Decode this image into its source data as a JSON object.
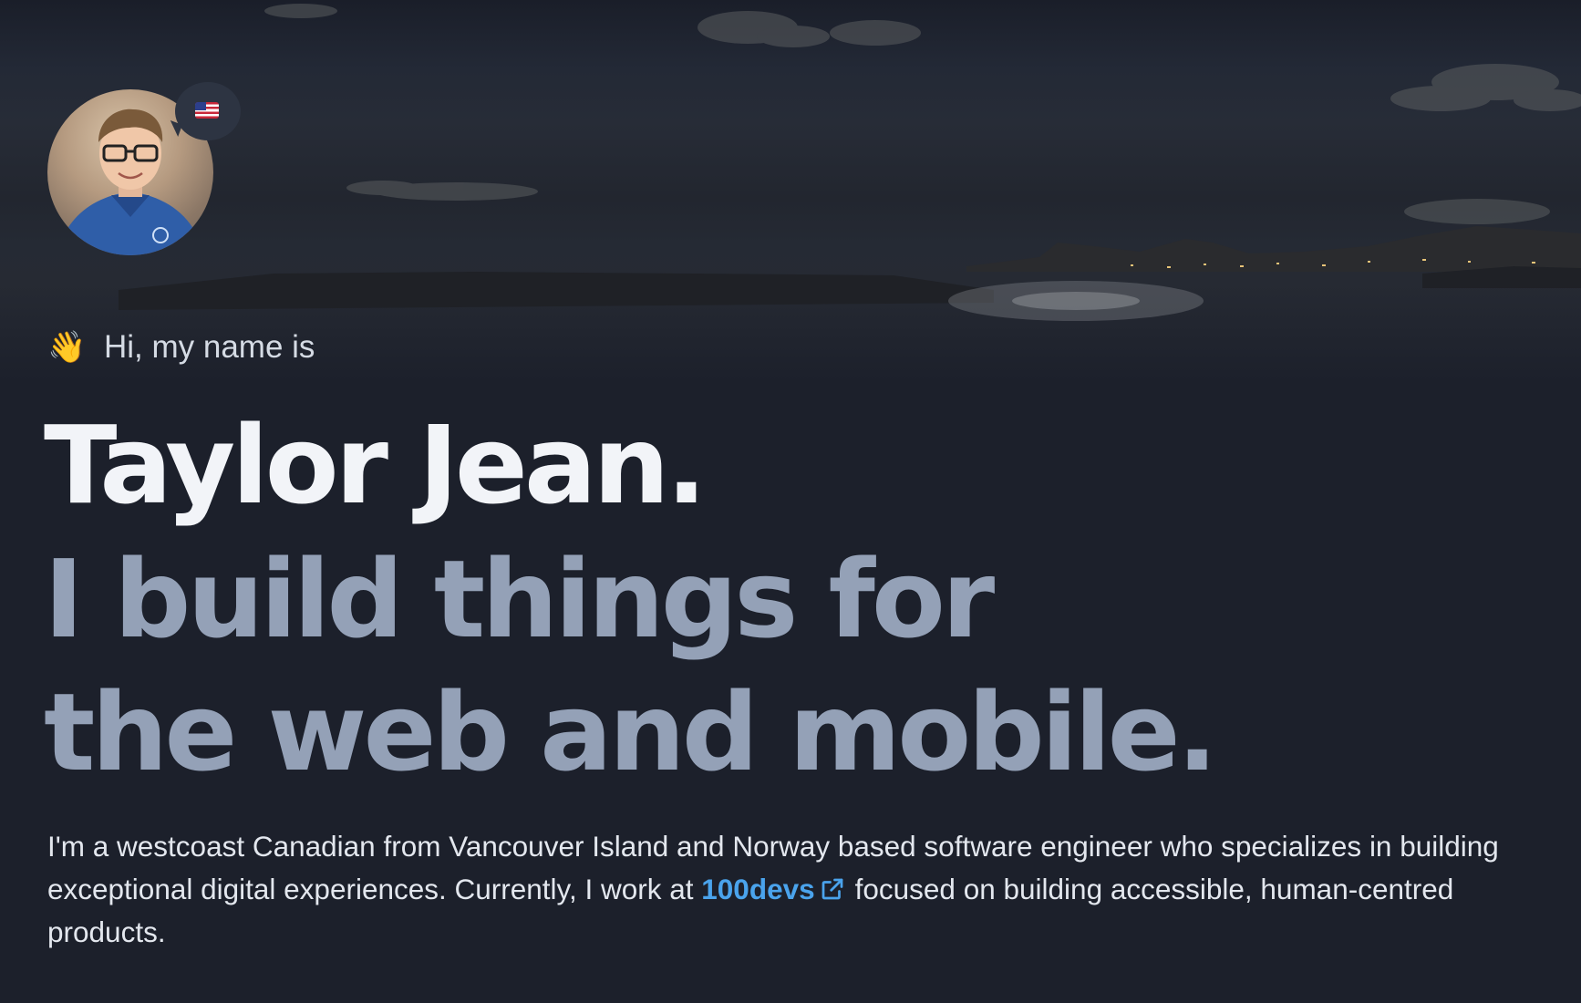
{
  "profile": {
    "avatar_alt": "avatar",
    "flag_icon": "us-flag-icon"
  },
  "intro": {
    "wave_emoji": "👋",
    "greeting": "Hi, my name is",
    "name": "Taylor Jean.",
    "tagline_line1": "I build things for",
    "tagline_line2": "the web and mobile."
  },
  "bio": {
    "text_before_link": "I'm a westcoast Canadian from Vancouver Island and Norway based software engineer who specializes in building exceptional digital experiences. Currently, I work at ",
    "link_label": "100devs",
    "text_after_link": "focused on building accessible, human-centred products."
  },
  "colors": {
    "background": "#1c202b",
    "name": "#f2f4f8",
    "tagline": "#94a1b7",
    "body_text": "#e3e7ee",
    "link": "#4aa3ec",
    "bubble": "#2d3442"
  }
}
